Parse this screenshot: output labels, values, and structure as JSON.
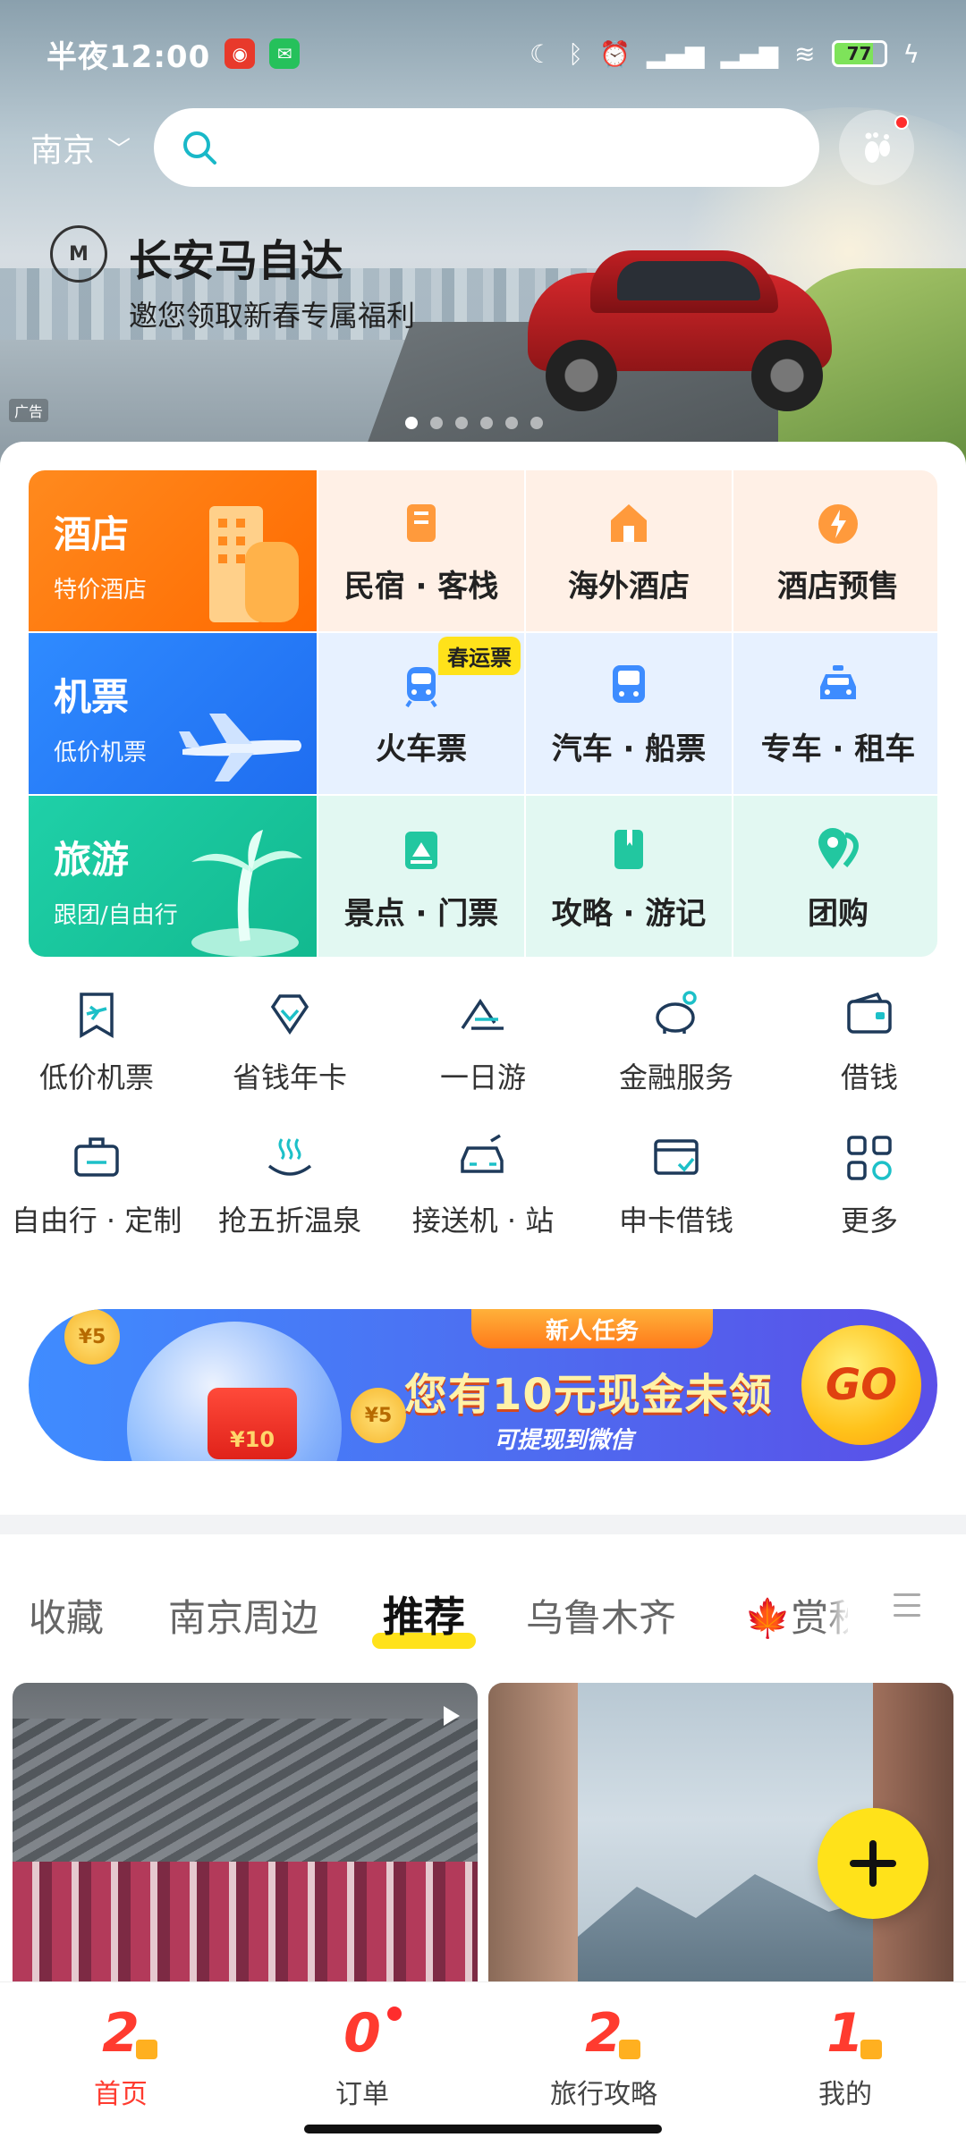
{
  "status_bar": {
    "time": "半夜12:00",
    "battery": "77"
  },
  "header": {
    "city": "南京",
    "search_placeholder": ""
  },
  "ad": {
    "brand": "长安马自达",
    "slogan": "邀您领取新春专属福利",
    "tag": "广告",
    "dots_total": 6,
    "active_dot": 1
  },
  "grid": {
    "hotel": {
      "title": "酒店",
      "sub": "特价酒店"
    },
    "flight": {
      "title": "机票",
      "sub": "低价机票"
    },
    "travel": {
      "title": "旅游",
      "sub": "跟团/自由行"
    },
    "cells": [
      {
        "label": "民宿 · 客栈",
        "icon": "homestay-icon"
      },
      {
        "label": "海外酒店",
        "icon": "overseas-hotel-icon"
      },
      {
        "label": "酒店预售",
        "icon": "presale-icon"
      },
      {
        "label": "火车票",
        "icon": "train-icon",
        "badge": "春运票"
      },
      {
        "label": "汽车 · 船票",
        "icon": "bus-icon"
      },
      {
        "label": "专车 · 租车",
        "icon": "car-icon"
      },
      {
        "label": "景点 · 门票",
        "icon": "ticket-icon"
      },
      {
        "label": "攻略 · 游记",
        "icon": "guide-icon"
      },
      {
        "label": "团购",
        "icon": "group-buy-icon"
      }
    ]
  },
  "quick": [
    {
      "label": "低价机票",
      "icon": "cheap-flight-icon"
    },
    {
      "label": "省钱年卡",
      "icon": "diamond-icon"
    },
    {
      "label": "一日游",
      "icon": "mountain-icon"
    },
    {
      "label": "金融服务",
      "icon": "piggy-bank-icon"
    },
    {
      "label": "借钱",
      "icon": "wallet-icon"
    },
    {
      "label": "自由行 · 定制",
      "icon": "suitcase-icon"
    },
    {
      "label": "抢五折温泉",
      "icon": "hot-spring-icon"
    },
    {
      "label": "接送机 · 站",
      "icon": "transfer-icon"
    },
    {
      "label": "申卡借钱",
      "icon": "credit-card-icon"
    },
    {
      "label": "更多",
      "icon": "grid-more-icon"
    }
  ],
  "promo": {
    "ribbon": "新人任务",
    "main": "您有10元现金未领",
    "sub": "可提现到微信",
    "go": "GO",
    "coin": "¥5",
    "redpack": "¥10"
  },
  "tabs": [
    {
      "label": "收藏"
    },
    {
      "label": "南京周边"
    },
    {
      "label": "推荐",
      "active": true
    },
    {
      "label": "乌鲁木齐"
    },
    {
      "label": "赏秋"
    }
  ],
  "bottom_nav": [
    {
      "label": "首页",
      "num": "2",
      "active": true
    },
    {
      "label": "订单",
      "num": "0",
      "dot": true
    },
    {
      "label": "旅行攻略",
      "num": "2"
    },
    {
      "label": "我的",
      "num": "1"
    }
  ],
  "colors": {
    "accent_yellow": "#ffe21a",
    "hotel_orange": "#ff7a10",
    "flight_blue": "#2a7cf8",
    "travel_green": "#19c59c",
    "nav_red": "#ff3b2f"
  }
}
